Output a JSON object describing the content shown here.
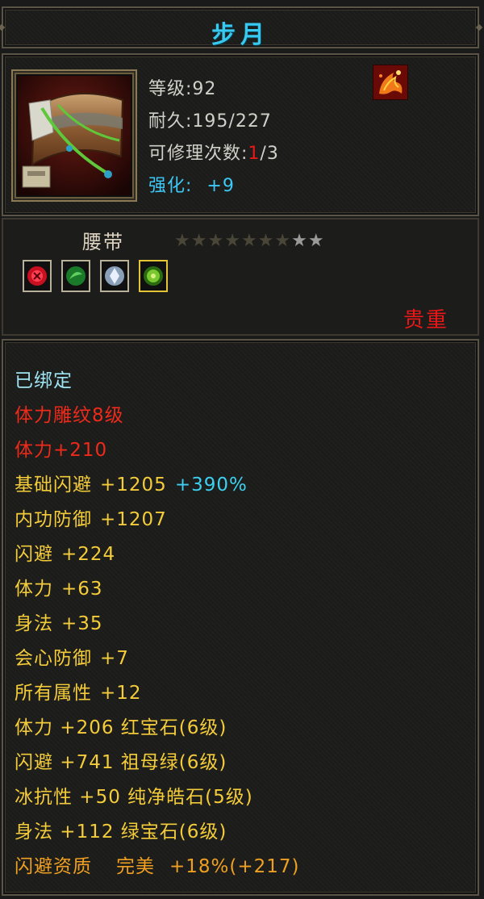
{
  "item": {
    "name": "步月",
    "level_label": "等级:",
    "level_value": "92",
    "durability_label": "耐久:",
    "durability_value": "195/227",
    "repair_label": "可修理次数:",
    "repair_used": "1",
    "repair_total": "/3",
    "enhance_label": "强化:",
    "enhance_value": "+9",
    "type": "腰带",
    "stars_total": 9,
    "stars_dark": 7,
    "rarity": "贵重"
  },
  "stats": {
    "bound": "已绑定",
    "engrave": "体力雕纹8级",
    "engrave_bonus": "体力+210",
    "base_dodge_label": "基础闪避",
    "base_dodge_value": "+1205",
    "base_dodge_pct": "+390%",
    "inner_def_label": "内功防御",
    "inner_def_value": "+1207",
    "dodge_label": "闪避",
    "dodge_value": "+224",
    "stamina_label": "体力",
    "stamina_value": "+63",
    "agility_label": "身法",
    "agility_value": "+35",
    "crit_def_label": "会心防御",
    "crit_def_value": "+7",
    "all_attr_label": "所有属性",
    "all_attr_value": "+12",
    "gem1": "体力 +206 红宝石(6级)",
    "gem2": "闪避 +741 祖母绿(6级)",
    "gem3": "冰抗性 +50 纯净皓石(5级)",
    "gem4": "身法 +112 绿宝石(6级)",
    "quality_label": "闪避资质",
    "quality_grade": "完美",
    "quality_value": "+18%(+217)"
  },
  "colors": {
    "title": "#39c9f0",
    "red": "#e81818",
    "yellow": "#f4cc3a",
    "cyan": "#9ee3f2",
    "orange": "#f0a020"
  },
  "icons": {
    "item": "belt-icon",
    "skill": "phoenix-skill-icon",
    "gems": [
      "red-gem-icon",
      "green-gem-icon",
      "white-gem-icon",
      "emerald-gem-icon"
    ]
  }
}
